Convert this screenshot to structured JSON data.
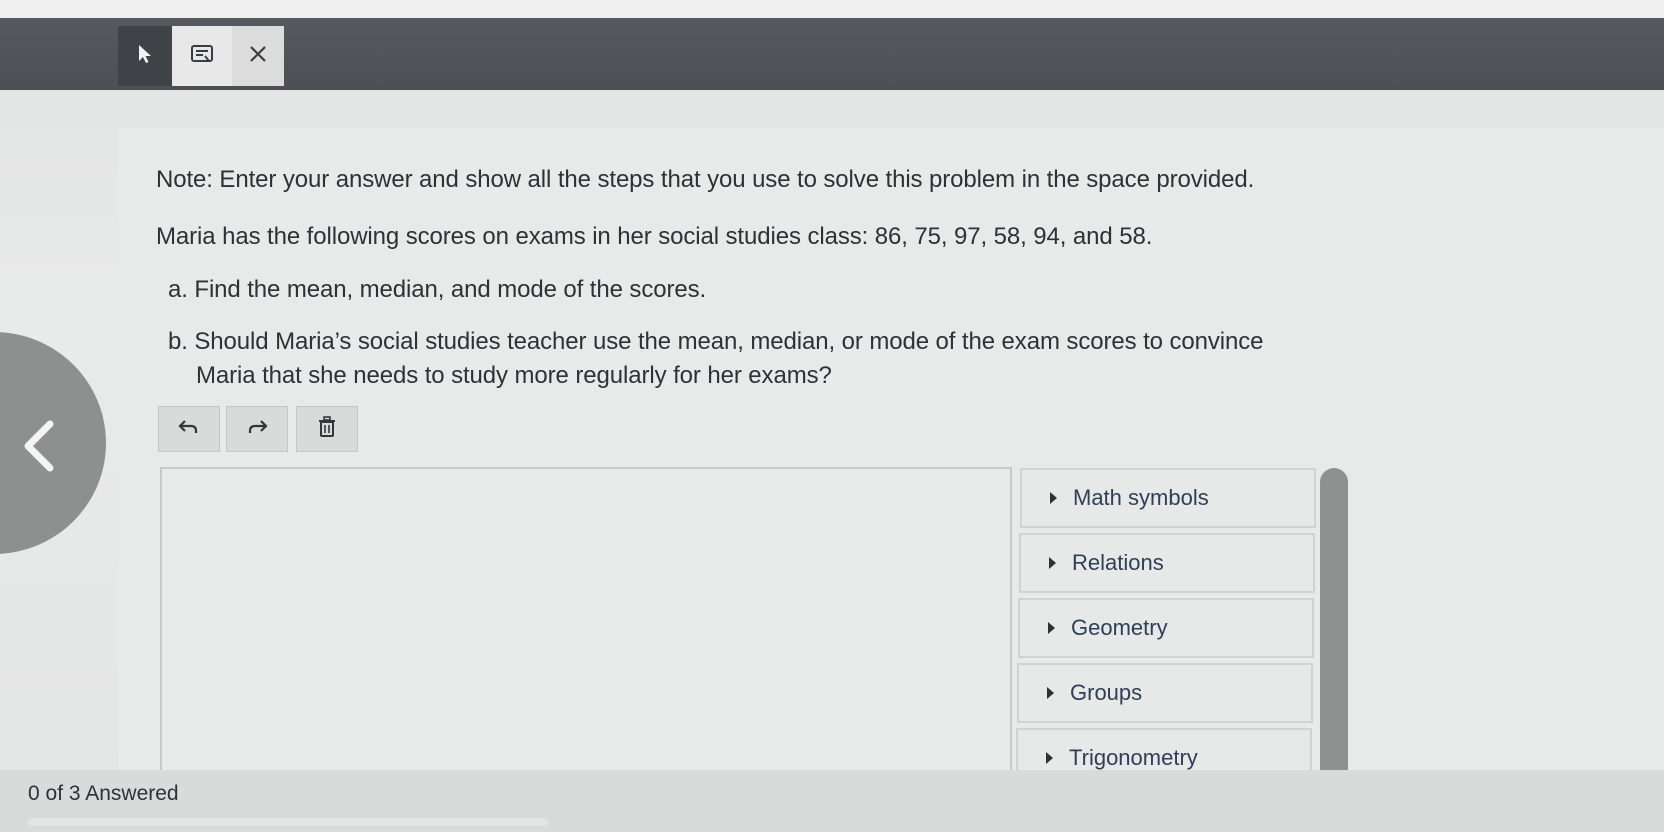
{
  "toolbar": {
    "tools": [
      {
        "icon": "cursor-icon"
      },
      {
        "icon": "note-icon"
      },
      {
        "icon": "close-icon"
      }
    ]
  },
  "question": {
    "note": "Note: Enter your answer and show all the steps that you use to solve this problem in the space provided.",
    "stem": "Maria has the following scores on exams in her social studies class: 86, 75, 97, 58, 94, and 58.",
    "part_a": "a. Find the mean, median, and mode of the scores.",
    "part_b_line1": "b. Should Maria’s social studies teacher use the mean, median, or mode of the exam scores to convince",
    "part_b_line2": "Maria that she needs to study more regularly for her exams?"
  },
  "editor": {
    "actions": [
      {
        "icon": "undo-icon"
      },
      {
        "icon": "redo-icon"
      },
      {
        "icon": "trash-icon"
      }
    ],
    "palette": [
      {
        "label": "Math symbols"
      },
      {
        "label": "Relations"
      },
      {
        "label": "Geometry"
      },
      {
        "label": "Groups"
      },
      {
        "label": "Trigonometry"
      }
    ]
  },
  "footer": {
    "answered_text": "0 of 3 Answered",
    "progress_fraction": 0
  },
  "colors": {
    "toolbar_bg": "#4c4f53",
    "accent": "#4a7bd0",
    "palette_text": "#2f3f58"
  }
}
